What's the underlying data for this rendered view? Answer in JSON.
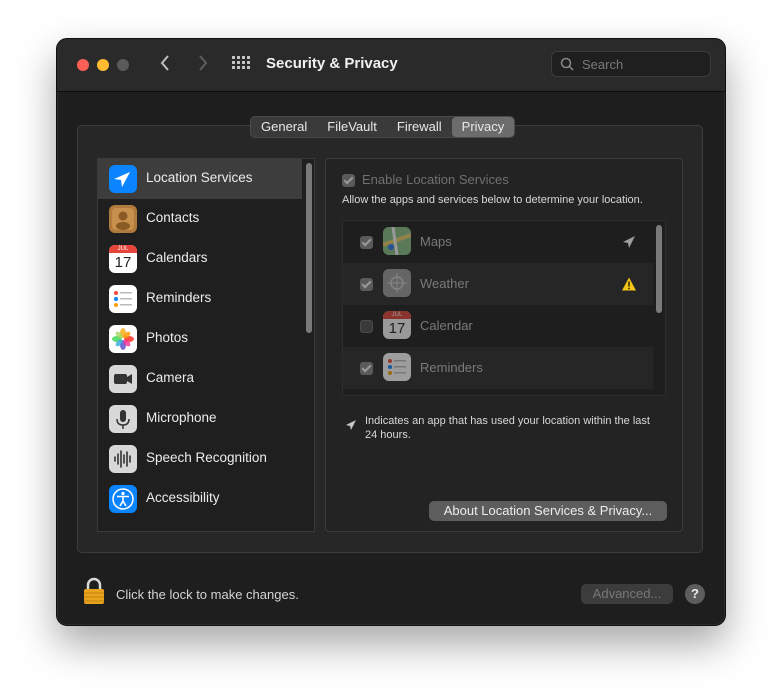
{
  "window": {
    "title": "Security & Privacy",
    "search_placeholder": "Search"
  },
  "tabs": [
    {
      "label": "General",
      "selected": false
    },
    {
      "label": "FileVault",
      "selected": false
    },
    {
      "label": "Firewall",
      "selected": false
    },
    {
      "label": "Privacy",
      "selected": true
    }
  ],
  "sidebar": {
    "items": [
      {
        "label": "Location Services",
        "icon": "location-arrow-icon",
        "selected": true
      },
      {
        "label": "Contacts",
        "icon": "contacts-icon",
        "selected": false
      },
      {
        "label": "Calendars",
        "icon": "calendar-icon",
        "selected": false,
        "icon_month": "JUL",
        "icon_day": "17"
      },
      {
        "label": "Reminders",
        "icon": "reminders-icon",
        "selected": false
      },
      {
        "label": "Photos",
        "icon": "photos-icon",
        "selected": false
      },
      {
        "label": "Camera",
        "icon": "camera-icon",
        "selected": false
      },
      {
        "label": "Microphone",
        "icon": "microphone-icon",
        "selected": false
      },
      {
        "label": "Speech Recognition",
        "icon": "speech-recognition-icon",
        "selected": false
      },
      {
        "label": "Accessibility",
        "icon": "accessibility-icon",
        "selected": false
      }
    ]
  },
  "location": {
    "enable_label": "Enable Location Services",
    "enable_checked": true,
    "description": "Allow the apps and services below to determine your location.",
    "apps": [
      {
        "name": "Maps",
        "checked": true,
        "icon": "maps-icon",
        "status": "location-arrow-icon"
      },
      {
        "name": "Weather",
        "checked": true,
        "icon": "weather-icon",
        "status": "warning-icon"
      },
      {
        "name": "Calendar",
        "checked": false,
        "icon": "calendar-icon",
        "status": "",
        "icon_month": "JUL",
        "icon_day": "17"
      },
      {
        "name": "Reminders",
        "checked": true,
        "icon": "reminders-icon",
        "status": ""
      }
    ],
    "note": "Indicates an app that has used your location within the last 24 hours.",
    "about_button": "About Location Services & Privacy..."
  },
  "footer": {
    "lock_text": "Click the lock to make changes.",
    "advanced_button": "Advanced...",
    "help_button": "?"
  },
  "colors": {
    "accent_blue": "#0a84ff",
    "close": "#fe5f57",
    "minimize": "#febc2e",
    "warning": "#f5c518",
    "lock": "#e8a21c"
  }
}
